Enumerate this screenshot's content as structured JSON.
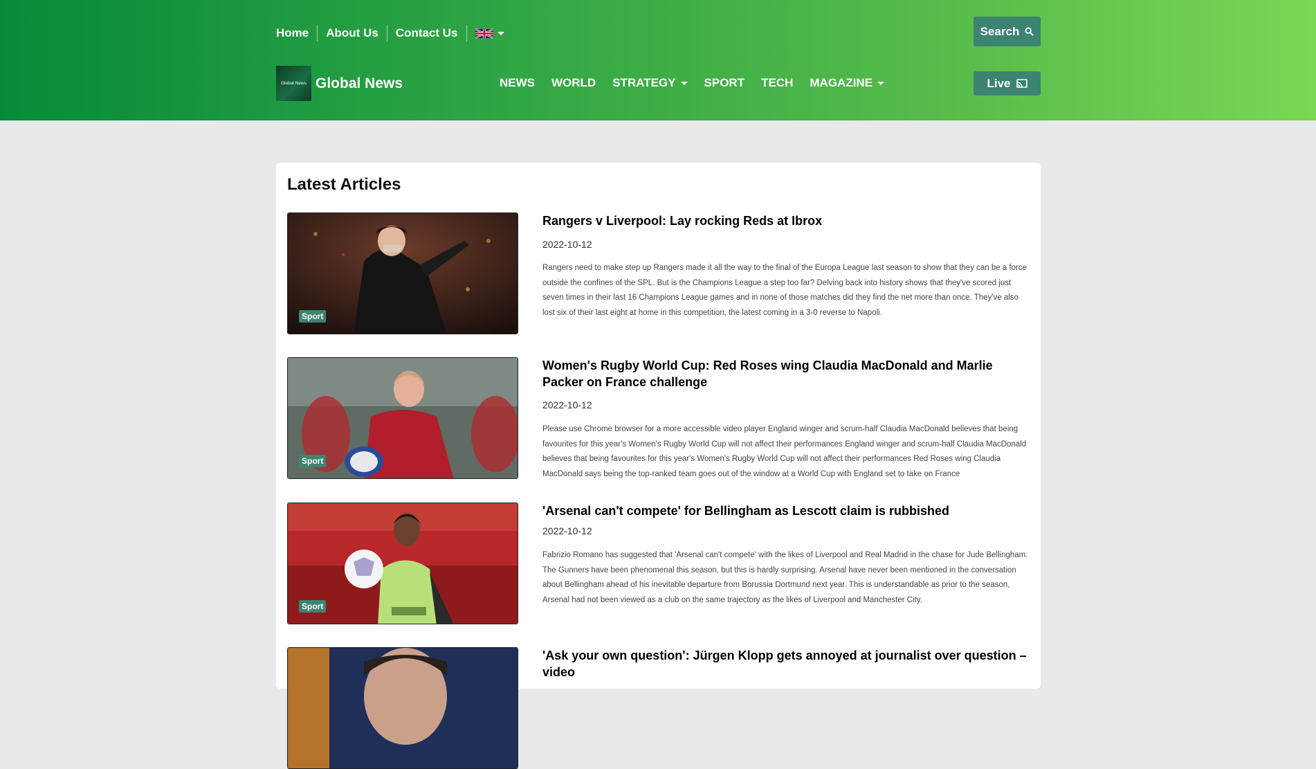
{
  "topnav": {
    "home": "Home",
    "about": "About Us",
    "contact": "Contact Us"
  },
  "header": {
    "search_label": "Search",
    "live_label": "Live",
    "brand_name": "Global News",
    "logo_text": "Global News"
  },
  "mainnav": {
    "items": [
      {
        "label": "NEWS"
      },
      {
        "label": "WORLD"
      },
      {
        "label": "STRATEGY"
      },
      {
        "label": "SPORT"
      },
      {
        "label": "TECH"
      },
      {
        "label": "MAGAZINE"
      }
    ]
  },
  "main": {
    "section_title": "Latest Articles",
    "articles": [
      {
        "title": "Rangers v Liverpool: Lay rocking Reds at Ibrox",
        "date": "2022-10-12",
        "category": "Sport",
        "description": "Rangers need to make step up Rangers made it all the way to the final of the Europa League last season to show that they can be a force outside the confines of the SPL. But is the Champions League a step too far? Delving back into history shows that they've scored just seven times in their last 16 Champions League games and in none of those matches did they find the net more than once. They've also lost six of their last eight at home in this competition, the latest coming in a 3-0 reverse to Napoli."
      },
      {
        "title": "Women's Rugby World Cup: Red Roses wing Claudia MacDonald and Marlie Packer on France challenge",
        "date": "2022-10-12",
        "category": "Sport",
        "description": "Please use Chrome browser for a more accessible video player England winger and scrum-half Claudia MacDonald believes that being favourites for this year's Women's Rugby World Cup will not affect their performances England winger and scrum-half Claudia MacDonald believes that being favourites for this year's Women's Rugby World Cup will not affect their performances Red Roses wing Claudia MacDonald says being the top-ranked team goes out of the window at a World Cup with England set to take on France"
      },
      {
        "title": "'Arsenal can't compete' for Bellingham as Lescott claim is rubbished",
        "date": "2022-10-12",
        "category": "Sport",
        "description": "Fabrizio Romano has suggested that 'Arsenal can't compete' with the likes of Liverpool and Real Madrid in the chase for Jude Bellingham. The Gunners have been phenomenal this season, but this is hardly surprising. Arsenal have never been mentioned in the conversation about Bellingham ahead of his inevitable departure from Borussia Dortmund next year. This is understandable as prior to the season, Arsenal had not been viewed as a club on the same trajectory as the likes of Liverpool and Manchester City."
      },
      {
        "title": "'Ask your own question': Jürgen Klopp gets annoyed at journalist over question – video"
      }
    ]
  }
}
